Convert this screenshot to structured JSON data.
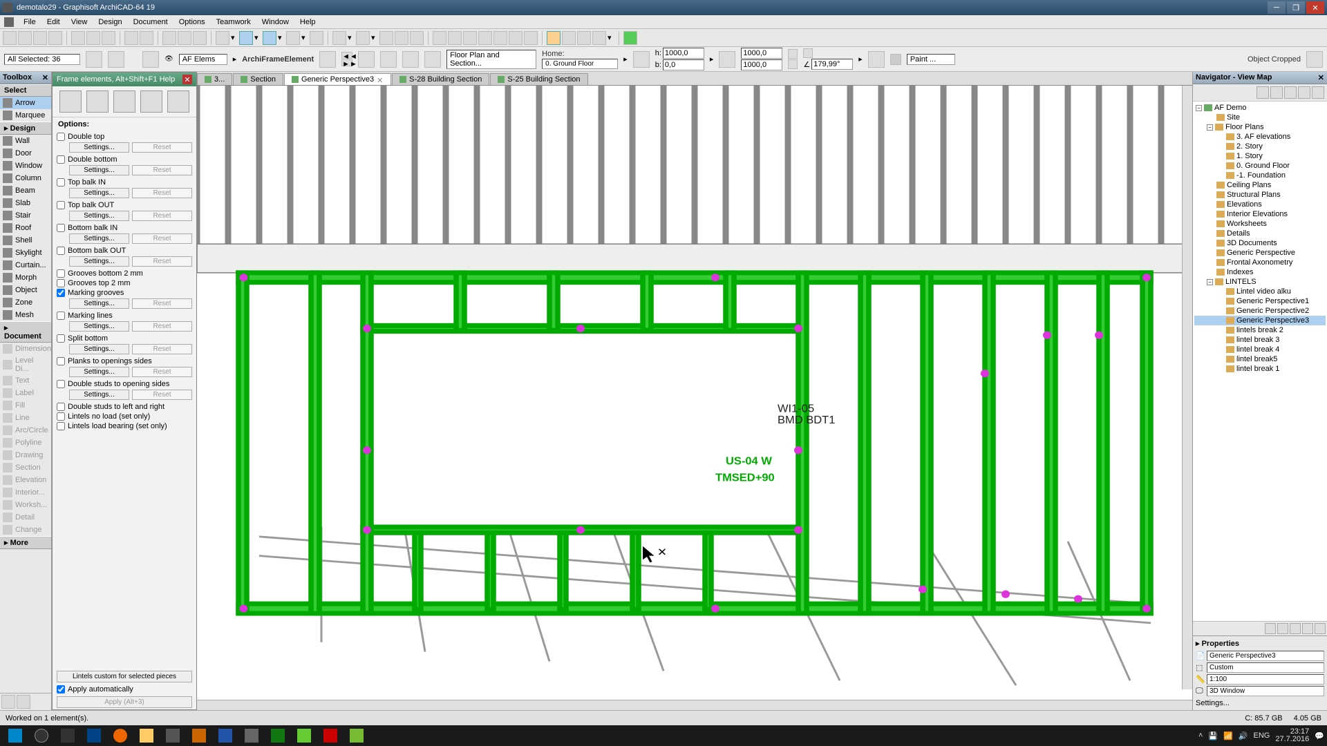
{
  "title": "demotalo29 - Graphisoft ArchiCAD-64 19",
  "menu": [
    "File",
    "Edit",
    "View",
    "Design",
    "Document",
    "Options",
    "Teamwork",
    "Window",
    "Help"
  ],
  "selection": "All Selected: 36",
  "element_type": "ArchiFrameElement",
  "af_elems": "AF Elems",
  "floorplan_btn": "Floor Plan and Section...",
  "home_label": "Home:",
  "home_value": "0. Ground Floor",
  "dims": {
    "h_label": "h:",
    "b_label": "b:",
    "h": "1000,0",
    "b": "0,0",
    "w1": "1000,0",
    "w2": "1000,0",
    "angle_icon": "∠",
    "angle": "179,99°"
  },
  "paint_label": "Paint ...",
  "cropped": "Object Cropped",
  "toolbox": {
    "title": "Toolbox",
    "select_header": "Select",
    "arrow": "Arrow",
    "marquee": "Marquee",
    "design_header": "Design",
    "design": [
      "Wall",
      "Door",
      "Window",
      "Column",
      "Beam",
      "Slab",
      "Stair",
      "Roof",
      "Shell",
      "Skylight",
      "Curtain...",
      "Morph",
      "Object",
      "Zone",
      "Mesh"
    ],
    "doc_header": "Document",
    "doc": [
      "Dimension",
      "Level Di...",
      "Text",
      "Label",
      "Fill",
      "Line",
      "Arc/Circle",
      "Polyline",
      "Drawing",
      "Section",
      "Elevation",
      "Interior...",
      "Worksh...",
      "Detail",
      "Change"
    ],
    "more": "More"
  },
  "dialog": {
    "title": "Frame elements, Alt+Shift+F1 Help",
    "options_label": "Options:",
    "opts": [
      {
        "label": "Double top",
        "checked": false,
        "settings": true
      },
      {
        "label": "Double bottom",
        "checked": false,
        "settings": true
      },
      {
        "label": "Top balk IN",
        "checked": false,
        "settings": true
      },
      {
        "label": "Top balk OUT",
        "checked": false,
        "settings": true
      },
      {
        "label": "Bottom balk IN",
        "checked": false,
        "settings": true
      },
      {
        "label": "Bottom balk OUT",
        "checked": false,
        "settings": true
      },
      {
        "label": "Grooves bottom 2 mm",
        "checked": false,
        "settings": false
      },
      {
        "label": "Grooves top 2 mm",
        "checked": false,
        "settings": false
      },
      {
        "label": "Marking grooves",
        "checked": true,
        "settings": true
      },
      {
        "label": "Marking lines",
        "checked": false,
        "settings": true
      },
      {
        "label": "Split bottom",
        "checked": false,
        "settings": true
      },
      {
        "label": "Planks to openings sides",
        "checked": false,
        "settings": true
      },
      {
        "label": "Double studs to opening sides",
        "checked": false,
        "settings": true
      },
      {
        "label": "Double studs to left and right",
        "checked": false,
        "settings": false
      },
      {
        "label": "Lintels no load (set only)",
        "checked": false,
        "settings": false
      },
      {
        "label": "Lintels load bearing (set only)",
        "checked": false,
        "settings": false
      }
    ],
    "settings_label": "Settings...",
    "reset_label": "Reset",
    "lintels_custom": "Lintels custom for selected pieces",
    "apply_auto": "Apply automatically",
    "apply": "Apply (Alt+3)"
  },
  "tabs": [
    {
      "label": "3...",
      "active": false
    },
    {
      "label": "Section",
      "active": false
    },
    {
      "label": "Generic Perspective3",
      "active": true
    },
    {
      "label": "S-28 Building Section",
      "active": false
    },
    {
      "label": "S-25 Building Section",
      "active": false
    }
  ],
  "viewport_labels": {
    "a": "WI1-05",
    "b": "BMD BDT1",
    "c": "US-04 W",
    "d": "TMSED+90"
  },
  "navigator": {
    "title": "Navigator - View Map",
    "root": "AF Demo",
    "tree": [
      {
        "l": "Site",
        "d": 1
      },
      {
        "l": "Floor Plans",
        "d": 1,
        "exp": true
      },
      {
        "l": "3. AF elevations",
        "d": 2
      },
      {
        "l": "2. Story",
        "d": 2
      },
      {
        "l": "1. Story",
        "d": 2
      },
      {
        "l": "0. Ground Floor",
        "d": 2
      },
      {
        "l": "-1. Foundation",
        "d": 2
      },
      {
        "l": "Ceiling Plans",
        "d": 1
      },
      {
        "l": "Structural Plans",
        "d": 1
      },
      {
        "l": "Elevations",
        "d": 1
      },
      {
        "l": "Interior Elevations",
        "d": 1
      },
      {
        "l": "Worksheets",
        "d": 1
      },
      {
        "l": "Details",
        "d": 1
      },
      {
        "l": "3D Documents",
        "d": 1
      },
      {
        "l": "Generic Perspective",
        "d": 1
      },
      {
        "l": "Frontal Axonometry",
        "d": 1
      },
      {
        "l": "Indexes",
        "d": 1
      },
      {
        "l": "LINTELS",
        "d": 1,
        "exp": true
      },
      {
        "l": "Lintel video alku",
        "d": 2
      },
      {
        "l": "Generic Perspective1",
        "d": 2
      },
      {
        "l": "Generic Perspective2",
        "d": 2
      },
      {
        "l": "Generic Perspective3",
        "d": 2,
        "sel": true
      },
      {
        "l": "lintels break 2",
        "d": 2
      },
      {
        "l": "lintel break 3",
        "d": 2
      },
      {
        "l": "lintel break 4",
        "d": 2
      },
      {
        "l": "lintel break5",
        "d": 2
      },
      {
        "l": "lintel break 1",
        "d": 2
      }
    ],
    "props_title": "Properties",
    "prop_name": "Generic Perspective3",
    "prop_custom": "Custom",
    "prop_scale": "1:100",
    "prop_window": "3D Window",
    "settings_btn": "Settings..."
  },
  "status": {
    "msg": "Worked on 1 element(s).",
    "disk": "C: 85.7 GB",
    "mem": "4.05 GB"
  },
  "taskbar": {
    "lang": "ENG",
    "time": "23:17",
    "date": "27.7.2016"
  }
}
